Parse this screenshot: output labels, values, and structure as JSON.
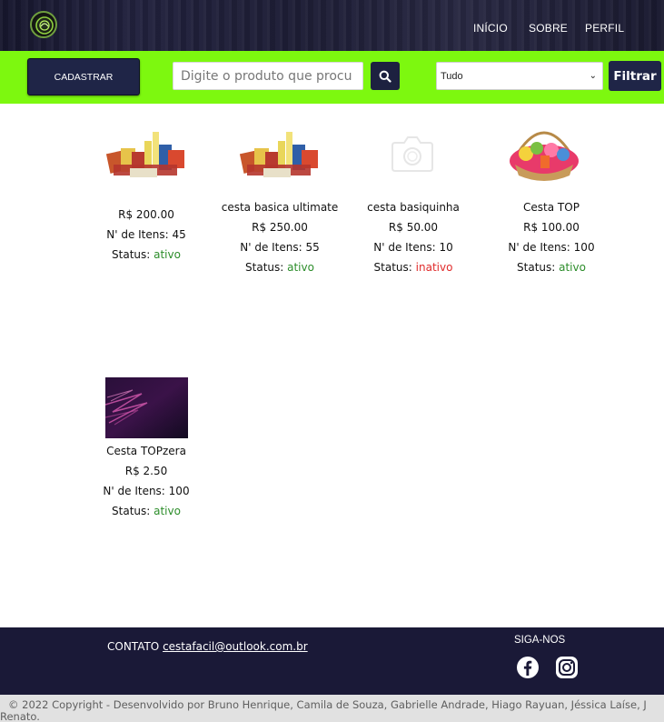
{
  "nav": {
    "inicio": "INÍCIO",
    "sobre": "SOBRE",
    "perfil": "PERFIL"
  },
  "toolbar": {
    "cadastrar_label": "CADASTRAR",
    "search_placeholder": "Digite o produto que procu",
    "select_value": "Tudo",
    "filter_label": "Filtrar"
  },
  "colors": {
    "header_bg": "#1c1c34",
    "toolbar_bg": "#7df80f",
    "button_bg": "#1f2547",
    "footer_bg": "#1a1937",
    "status_active": "#2c8d2a",
    "status_inactive": "#e02b2b"
  },
  "products": [
    {
      "name": "",
      "price": "R$ 200.00",
      "items": "N' de Itens: 45",
      "status_label": "Status: ",
      "status": "ativo",
      "image": "grocery-photo"
    },
    {
      "name": "cesta basica ultimate",
      "price": "R$ 250.00",
      "items": "N' de Itens: 55",
      "status_label": "Status: ",
      "status": "ativo",
      "image": "grocery-photo"
    },
    {
      "name": "cesta basiquinha",
      "price": "R$ 50.00",
      "items": "N' de Itens: 10",
      "status_label": "Status: ",
      "status": "inativo",
      "image": "camera-placeholder-icon"
    },
    {
      "name": "Cesta TOP",
      "price": "R$ 100.00",
      "items": "N' de Itens: 100",
      "status_label": "Status: ",
      "status": "ativo",
      "image": "gift-basket-photo"
    },
    {
      "name": "Cesta TOPzera",
      "price": "R$ 2.50",
      "items": "N' de Itens: 100",
      "status_label": "Status: ",
      "status": "ativo",
      "image": "purple-abstract-photo"
    }
  ],
  "footer": {
    "contato_label": "CONTATO ",
    "email": "cestafacil@outlook.com.br",
    "siga_label": "SIGA-NOS",
    "social_icons": [
      "facebook-icon",
      "instagram-icon"
    ],
    "copyright_line1": "© 2022 Copyright - Desenvolvido por Bruno Henrique, Camila de Souza, Gabrielle Andrade, Hiago Rayuan, Jéssica Laíse, J",
    "copyright_line2": "Renato."
  }
}
